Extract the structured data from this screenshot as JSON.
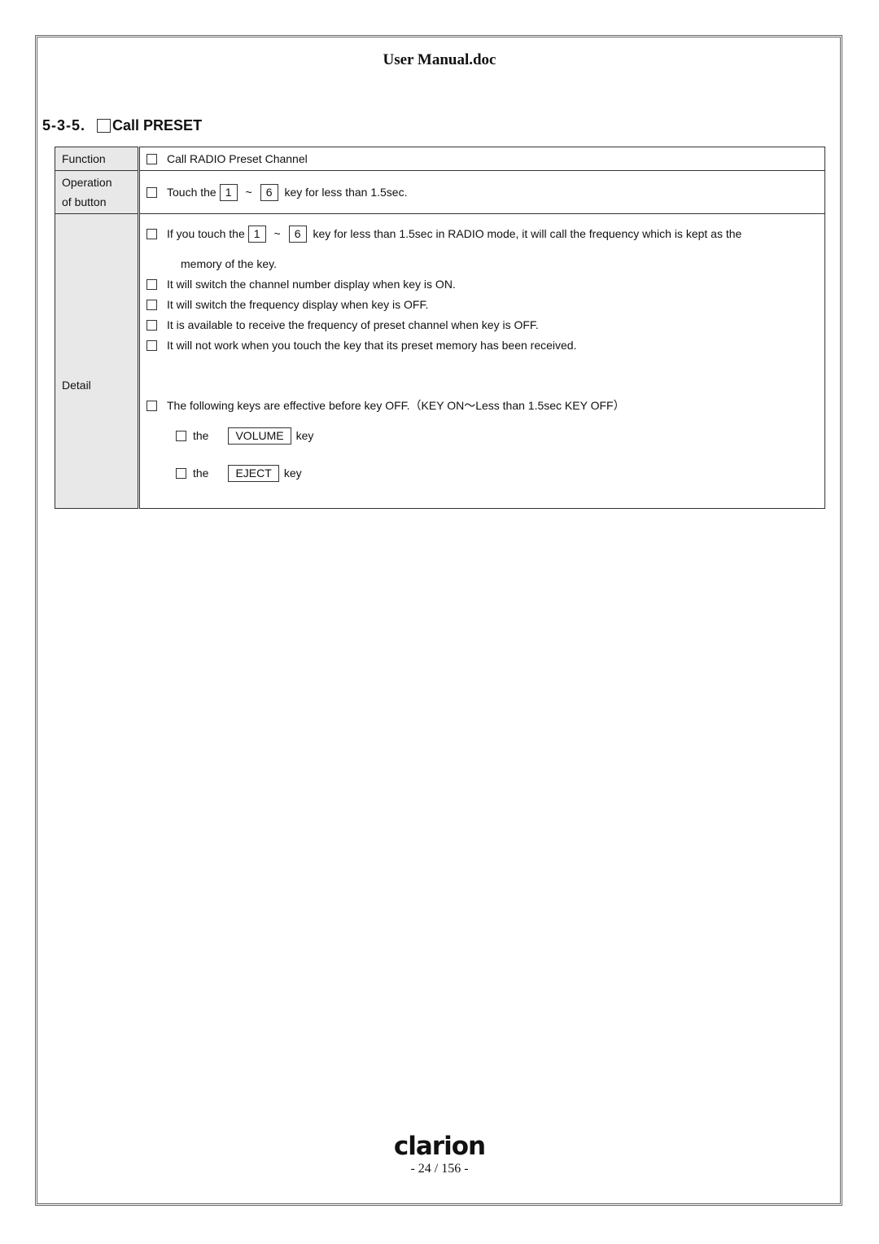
{
  "document": {
    "title": "User Manual.doc",
    "section_number": "5-3-5.",
    "section_title": "Call PRESET",
    "logo": "clarion",
    "page_indicator": "- 24 / 156 -"
  },
  "table": {
    "function": {
      "label": "Function",
      "text": "Call RADIO Preset Channel"
    },
    "operation": {
      "label_line1": "Operation",
      "label_line2": "of button",
      "prefix": "Touch the",
      "key_from": "1",
      "tilde": "~",
      "key_to": "6",
      "suffix": "key for less than 1.5sec."
    },
    "detail": {
      "label": "Detail",
      "item1_prefix": "If you touch the",
      "item1_key_from": "1",
      "item1_tilde": "~",
      "item1_key_to": "6",
      "item1_suffix": "key for less than 1.5sec in RADIO mode, it will call the frequency which is kept as the",
      "item1_continuation": "memory of the key.",
      "items": [
        "It will switch the channel number display when key is ON.",
        "It will switch the frequency display when key is OFF.",
        "It is available to receive the frequency of preset channel when key is OFF.",
        "It will not work when you touch the key that its preset memory has been received."
      ],
      "effective_note": "The following keys are effective before key OFF.（KEY ON～Less than 1.5sec KEY OFF）",
      "sub_items": [
        {
          "prefix": "the",
          "key": "VOLUME",
          "suffix": "key"
        },
        {
          "prefix": "the",
          "key": "EJECT",
          "suffix": "key"
        }
      ]
    }
  }
}
